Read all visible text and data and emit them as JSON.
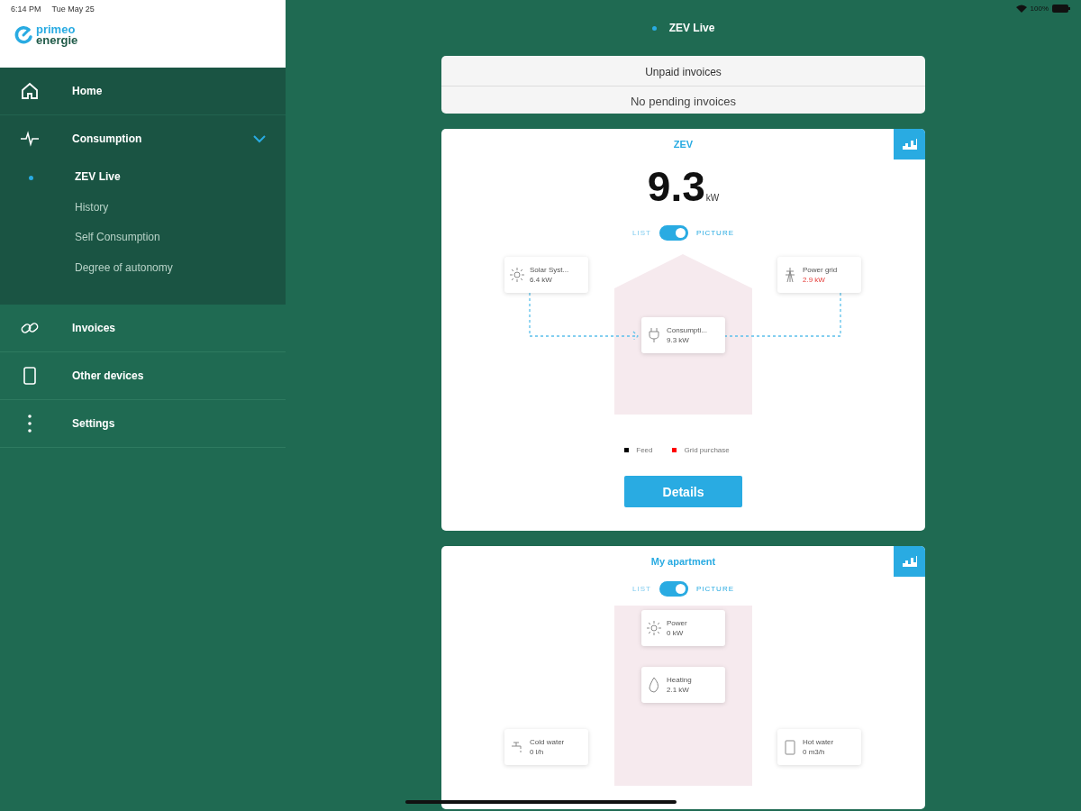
{
  "status_bar": {
    "time": "6:14 PM",
    "date": "Tue May 25",
    "battery": "100%"
  },
  "sidebar": {
    "logo": {
      "line_1": "primeo",
      "line_2": "energie"
    },
    "items": [
      {
        "label": "Home"
      },
      {
        "label": "Consumption",
        "expanded": true,
        "children": [
          {
            "label": "ZEV Live",
            "selected": true
          },
          {
            "label": "History",
            "selected": false
          },
          {
            "label": "Self Consumption",
            "selected": false
          },
          {
            "label": "Degree of autonomy",
            "selected": false
          }
        ]
      },
      {
        "label": "Invoices"
      },
      {
        "label": "Other devices"
      },
      {
        "label": "Settings"
      }
    ]
  },
  "page_title": "ZEV Live",
  "invoices": {
    "title": "Unpaid invoices",
    "message": "No pending invoices"
  },
  "cards": [
    {
      "title": "ZEV",
      "kind": "building",
      "total": {
        "value": "9.3",
        "unit": "kW"
      },
      "toggle": {
        "left": "LIST",
        "right": "PICTURE",
        "on": true
      },
      "nodes": [
        {
          "name": "Solar Syst...",
          "value": "6.4 kW",
          "warning": false
        },
        {
          "name": "Power grid",
          "value": "2.9 kW",
          "warning": true
        },
        {
          "name": "Consumpti...",
          "value": "9.3 kW",
          "warning": false
        }
      ],
      "legend": [
        {
          "label": "Feed",
          "color": "#000000"
        },
        {
          "label": "Grid purchase",
          "color": "#ff0000"
        }
      ],
      "button": "Details"
    },
    {
      "title": "My apartment",
      "kind": "apartment",
      "toggle": {
        "left": "LIST",
        "right": "PICTURE",
        "on": true
      },
      "nodes": [
        {
          "name": "Power",
          "value": "0 kW",
          "warning": false
        },
        {
          "name": "Heating",
          "value": "2.1 kW",
          "warning": false
        },
        {
          "name": "Cold water",
          "value": "0 l/h",
          "warning": false
        },
        {
          "name": "Hot water",
          "value": "0 m3/h",
          "warning": false
        }
      ]
    }
  ]
}
